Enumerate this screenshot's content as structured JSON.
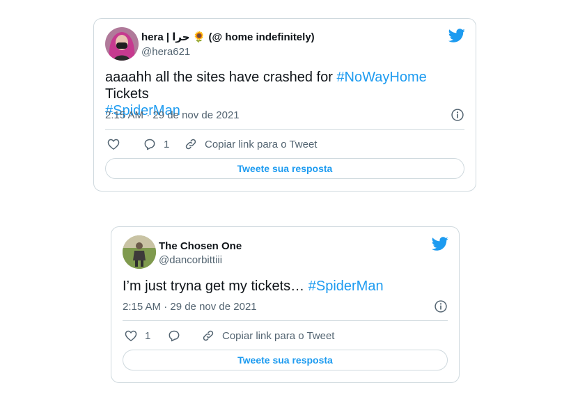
{
  "colors": {
    "accent": "#1d9bf0",
    "border": "#cfd9de",
    "muted": "#536471",
    "text": "#0f1419"
  },
  "tweets": [
    {
      "display_name": "hera | حرا 🌻 (@ home indefinitely)",
      "handle": "@hera621",
      "text_before": "aaaahh all the sites have crashed for ",
      "hashtag1": "#NoWayHome",
      "text_middle": " Tickets",
      "hashtag2": "#SpiderMan",
      "timestamp": "2:15 AM · 29 de nov de 2021",
      "reply_count": "1",
      "copy_link_label": "Copiar link para o Tweet",
      "reply_button_label": "Tweete sua resposta",
      "icons": [
        "twitter-bird-icon",
        "info-icon",
        "heart-icon",
        "reply-icon",
        "link-icon"
      ]
    },
    {
      "display_name": "The Chosen One",
      "handle": "@dancorbittiii",
      "text_before": "I’m just tryna get my tickets… ",
      "hashtag1": "#SpiderMan",
      "timestamp": "2:15 AM · 29 de nov de 2021",
      "like_count": "1",
      "copy_link_label": "Copiar link para o Tweet",
      "reply_button_label": "Tweete sua resposta",
      "icons": [
        "twitter-bird-icon",
        "info-icon",
        "heart-icon",
        "reply-icon",
        "link-icon"
      ]
    }
  ]
}
